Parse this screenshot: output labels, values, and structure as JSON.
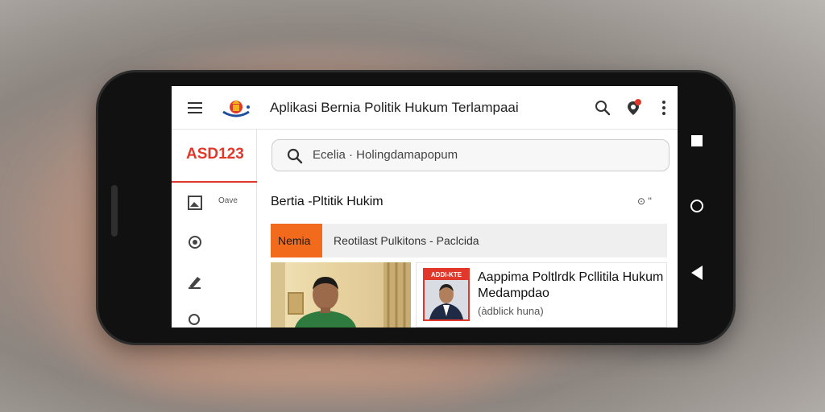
{
  "app": {
    "title": "Aplikasi Bernia Politik Hukum Terlampaai",
    "brand_code": "ASD123"
  },
  "search": {
    "value": "Ecelia · Holingdamapopum",
    "placeholder": ""
  },
  "section": {
    "title": "Bertia -Pltitik Hukim",
    "actions": "⊙ ''"
  },
  "sidebar": {
    "items": [
      {
        "icon": "image-icon",
        "label": "Oave"
      },
      {
        "icon": "settings-icon",
        "label": ""
      },
      {
        "icon": "pen-icon",
        "label": ""
      },
      {
        "icon": "search-icon",
        "label": ""
      }
    ]
  },
  "tabs": {
    "active": "Nemia",
    "subtitle": "Reotilast Pulkitons - Paclcida"
  },
  "article": {
    "badge": "ADDI-KTE",
    "headline": "Aappima Poltlrdk Pcllitila Hukum Medampdao",
    "meta": "(àdblick huna)"
  },
  "colors": {
    "accent": "#e2382c",
    "tab_active": "#f26b1d"
  }
}
